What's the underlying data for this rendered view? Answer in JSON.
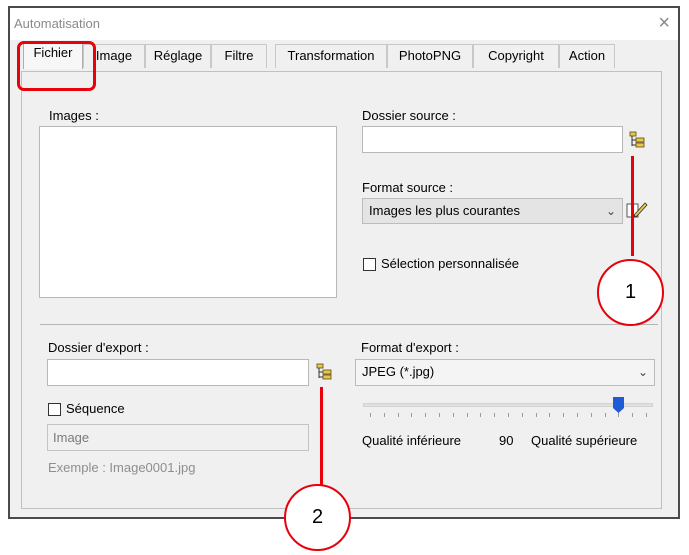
{
  "window": {
    "title": "Automatisation",
    "close_glyph": "×"
  },
  "tabs": [
    {
      "label": "Fichier",
      "active": true
    },
    {
      "label": "Image",
      "active": false
    },
    {
      "label": "Réglage",
      "active": false
    },
    {
      "label": "Filtre",
      "active": false
    },
    {
      "label": "Transformation",
      "active": false
    },
    {
      "label": "PhotoPNG",
      "active": false
    },
    {
      "label": "Copyright",
      "active": false
    },
    {
      "label": "Action",
      "active": false
    }
  ],
  "images": {
    "label": "Images :"
  },
  "source": {
    "folder_label": "Dossier source :",
    "folder_value": "",
    "format_label": "Format source :",
    "format_value": "Images les plus courantes",
    "custom_selection_label": "Sélection personnalisée",
    "custom_selection_checked": false
  },
  "export": {
    "folder_label": "Dossier d'export :",
    "folder_value": "",
    "sequence_label": "Séquence",
    "sequence_checked": false,
    "sequence_placeholder": "Image",
    "example_text": "Exemple : Image0001.jpg",
    "format_label": "Format d'export :",
    "format_value": "JPEG (*.jpg)"
  },
  "quality": {
    "low_label": "Qualité inférieure",
    "value": "90",
    "high_label": "Qualité supérieure",
    "slider_fraction": 0.88
  },
  "annotations": {
    "callout_1": "1",
    "callout_2": "2",
    "accent_color": "#e8000a"
  },
  "icons": {
    "folder_browse": "folder-tree-icon",
    "edit": "pencil-edit-icon",
    "dropdown": "chevron-down-icon",
    "close": "close-icon"
  }
}
